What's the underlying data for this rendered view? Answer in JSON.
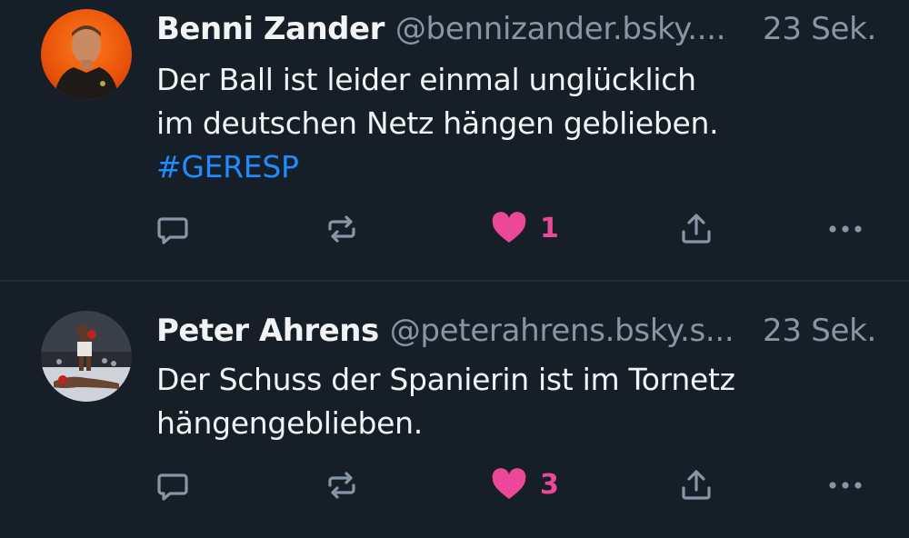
{
  "colors": {
    "background": "#161e27",
    "text": "#f1f3f5",
    "muted": "#8696a7",
    "hashtag": "#208bfe",
    "like": "#ec4899"
  },
  "posts": [
    {
      "author": "Benni Zander",
      "handle": "@bennizander.bsky....",
      "time": "23 Sek.",
      "text_lines": [
        "Der Ball ist leider einmal unglücklich",
        "im deutschen Netz hängen geblieben."
      ],
      "hashtag": "#GERESP",
      "likes": "1",
      "liked": true,
      "icons": [
        "reply-icon",
        "repost-icon",
        "heart-icon",
        "share-icon",
        "more-icon"
      ]
    },
    {
      "author": "Peter Ahrens",
      "handle": "@peterahrens.bsky.s...",
      "time": "23 Sek.",
      "text_lines": [
        "Der Schuss der Spanierin ist im Tornetz",
        "hängengeblieben."
      ],
      "likes": "3",
      "liked": true,
      "icons": [
        "reply-icon",
        "repost-icon",
        "heart-icon",
        "share-icon",
        "more-icon"
      ]
    }
  ]
}
